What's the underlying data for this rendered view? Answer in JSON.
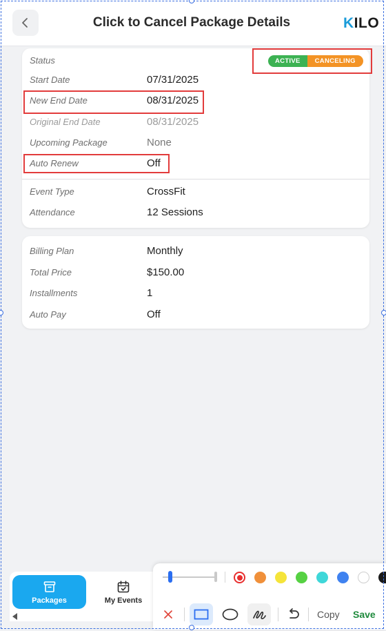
{
  "header": {
    "title": "Click to Cancel Package Details",
    "logo": "KILO"
  },
  "status": {
    "label": "Status",
    "badges": [
      "ACTIVE",
      "CANCELING"
    ],
    "colors": {
      "active": "#3cb253",
      "canceling": "#f39325"
    }
  },
  "package_details": [
    {
      "label": "Start Date",
      "value": "07/31/2025"
    },
    {
      "label": "New End Date",
      "value": "08/31/2025"
    },
    {
      "label": "Original End Date",
      "value": "08/31/2025"
    },
    {
      "label": "Upcoming Package",
      "value": "None"
    },
    {
      "label": "Auto Renew",
      "value": "Off"
    }
  ],
  "event_details": [
    {
      "label": "Event Type",
      "value": "CrossFit"
    },
    {
      "label": "Attendance",
      "value": "12 Sessions"
    }
  ],
  "billing_details": [
    {
      "label": "Billing Plan",
      "value": "Monthly"
    },
    {
      "label": "Total Price",
      "value": "$150.00"
    },
    {
      "label": "Installments",
      "value": "1"
    },
    {
      "label": "Auto Pay",
      "value": "Off"
    }
  ],
  "bottom_nav": [
    {
      "label": "Packages",
      "icon": "package-icon",
      "active": true
    },
    {
      "label": "My Events",
      "icon": "calendar-check-icon",
      "active": false
    }
  ],
  "annotation_toolbar": {
    "colors": [
      "#e82e2e",
      "#f0903a",
      "#f5e43a",
      "#56d143",
      "#3fd7d9",
      "#3f82f0",
      "#ffffff",
      "#1a1a1a"
    ],
    "tools": [
      "close-icon",
      "rectangle-icon",
      "ellipse-icon",
      "freehand-icon",
      "undo-icon"
    ],
    "copy_label": "Copy",
    "save_label": "Save"
  },
  "accent": "#1aa8ef"
}
